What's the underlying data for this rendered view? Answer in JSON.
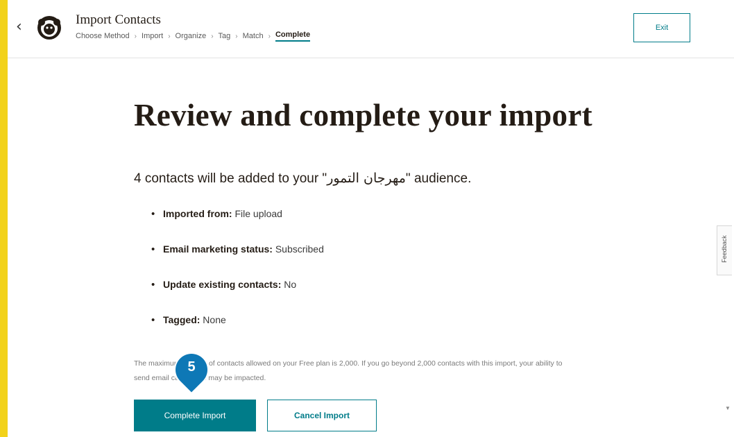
{
  "header": {
    "title": "Import Contacts",
    "breadcrumbs": [
      "Choose Method",
      "Import",
      "Organize",
      "Tag",
      "Match",
      "Complete"
    ],
    "active_step": "Complete",
    "separator": "›",
    "exit_label": "Exit"
  },
  "main": {
    "title": "Review and complete your import",
    "summary_prefix": "4 contacts will be added to your \"",
    "audience_name": "مهرجان التمور",
    "summary_suffix": "\" audience.",
    "details": [
      {
        "label": "Imported from:",
        "value": "File upload"
      },
      {
        "label": "Email marketing status:",
        "value": "Subscribed"
      },
      {
        "label": "Update existing contacts:",
        "value": "No"
      },
      {
        "label": "Tagged:",
        "value": "None"
      }
    ],
    "note": "The maximum number of contacts allowed on your Free plan is 2,000. If you go beyond 2,000 contacts with this import, your ability to send email campaigns may be impacted.",
    "complete_button": "Complete Import",
    "cancel_button": "Cancel Import"
  },
  "feedback_label": "Feedback",
  "step_marker": "5",
  "colors": {
    "accent": "#007c89",
    "sidebar": "#f2d21a",
    "marker": "#0e78b6"
  }
}
